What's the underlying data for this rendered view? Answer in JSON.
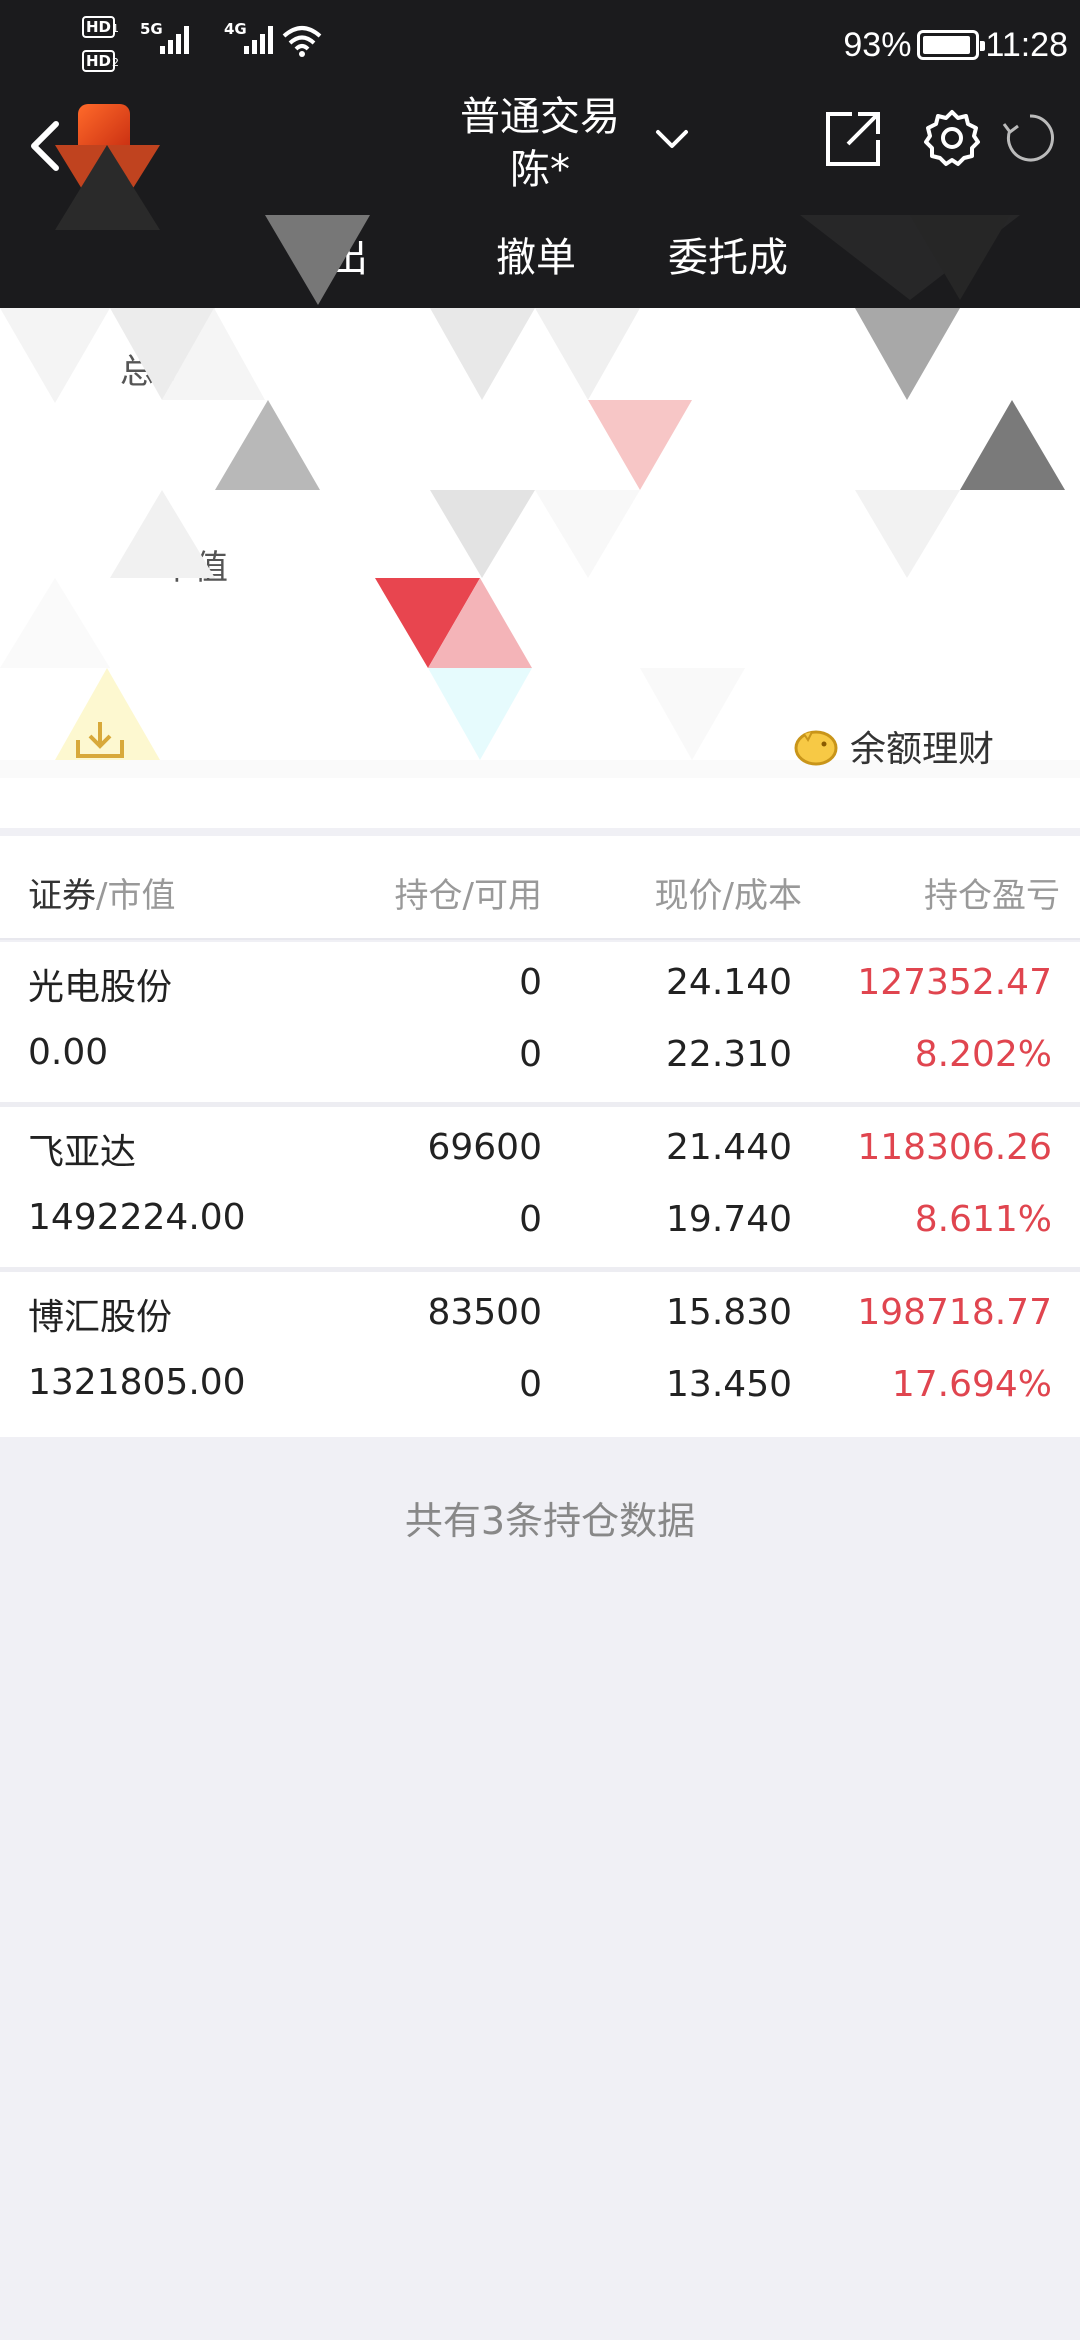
{
  "status_bar": {
    "sim1_badge": "HD",
    "sim1_num": "1",
    "sim2_badge": "HD",
    "sim2_num": "2",
    "net1": "5G",
    "net2": "4G",
    "battery": "93%",
    "battery_level": 0.93,
    "time": "11:28",
    "icons": [
      "signal-icon",
      "wifi-icon",
      "battery-icon"
    ]
  },
  "header": {
    "title": "普通交易",
    "account": "陈*",
    "icons": [
      "back-icon",
      "app-logo-icon",
      "dropdown-icon",
      "share-icon",
      "settings-icon",
      "refresh-icon"
    ]
  },
  "tabs": [
    {
      "label": "出"
    },
    {
      "label": "撤单"
    },
    {
      "label": "委托成"
    }
  ],
  "summary": {
    "total_assets_label": "总资产",
    "market_value_label": "市值",
    "wealth_label": "余额理财"
  },
  "table": {
    "headers": {
      "security": "证券",
      "market_value": "/市值",
      "position": "持仓/可用",
      "price": "现价/成本",
      "pnl": "持仓盈亏"
    },
    "rows": [
      {
        "name": "光电股份",
        "market_value": "0.00",
        "position": "0",
        "available": "0",
        "price": "24.140",
        "cost": "22.310",
        "pnl": "127352.47",
        "pnl_pct": "8.202%"
      },
      {
        "name": "飞亚达",
        "market_value": "1492224.00",
        "position": "69600",
        "available": "0",
        "price": "21.440",
        "cost": "19.740",
        "pnl": "118306.26",
        "pnl_pct": "8.611%"
      },
      {
        "name": "博汇股份",
        "market_value": "1321805.00",
        "position": "83500",
        "available": "0",
        "price": "15.830",
        "cost": "13.450",
        "pnl": "198718.77",
        "pnl_pct": "17.694%"
      }
    ]
  },
  "footer": {
    "note": "共有3条持仓数据"
  },
  "colors": {
    "header_bg": "#1b1b1d",
    "profit_red": "#e0454f",
    "page_bg": "#f0f0f5"
  }
}
